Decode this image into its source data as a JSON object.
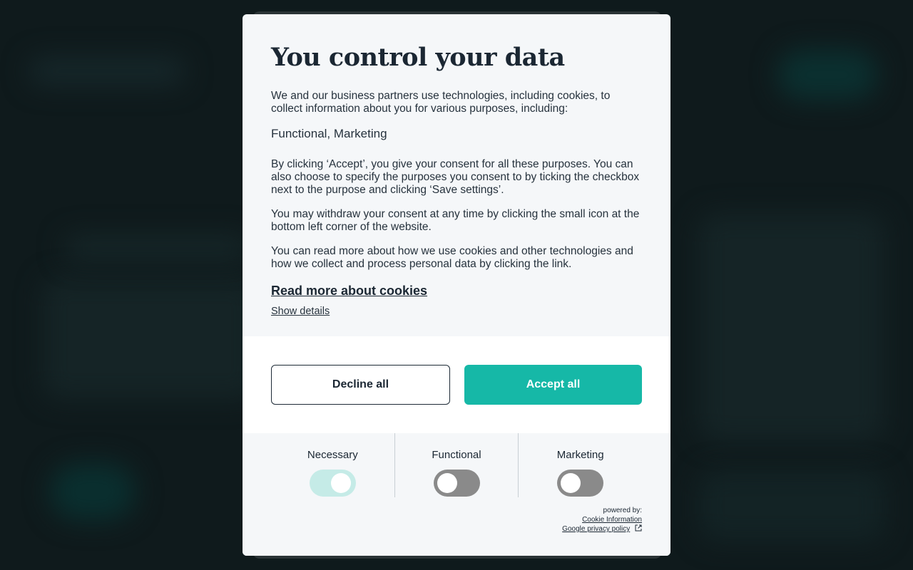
{
  "dialog": {
    "title": "You control your data",
    "intro": "We and our business partners use technologies, including cookies, to collect information about you for various purposes, including:",
    "purposes": "Functional, Marketing",
    "consent_text": "By clicking ‘Accept’, you give your consent for all these purposes. You can also choose to specify the purposes you consent to by ticking the checkbox next to the purpose and clicking ‘Save settings’.",
    "withdraw_text": "You may withdraw your consent at any time by clicking the small icon at the bottom left corner of the website.",
    "read_more_text": "You can read more about how we use cookies and other technologies and how we collect and process personal data by clicking the link.",
    "read_more_link": "Read more about cookies",
    "show_details": "Show details"
  },
  "buttons": {
    "decline": "Decline all",
    "accept": "Accept all"
  },
  "toggles": [
    {
      "label": "Necessary",
      "state": "on",
      "disabled": true
    },
    {
      "label": "Functional",
      "state": "off"
    },
    {
      "label": "Marketing",
      "state": "off"
    }
  ],
  "footer": {
    "powered_by": "powered by:",
    "provider_link": "Cookie Information",
    "privacy_link": "Google privacy policy",
    "external_icon": "external-link-icon"
  },
  "colors": {
    "accent": "#16b8a7",
    "toggle_on": "#c5ebe7",
    "toggle_off": "#8a8a8a",
    "overlay": "#0f1a1c"
  }
}
